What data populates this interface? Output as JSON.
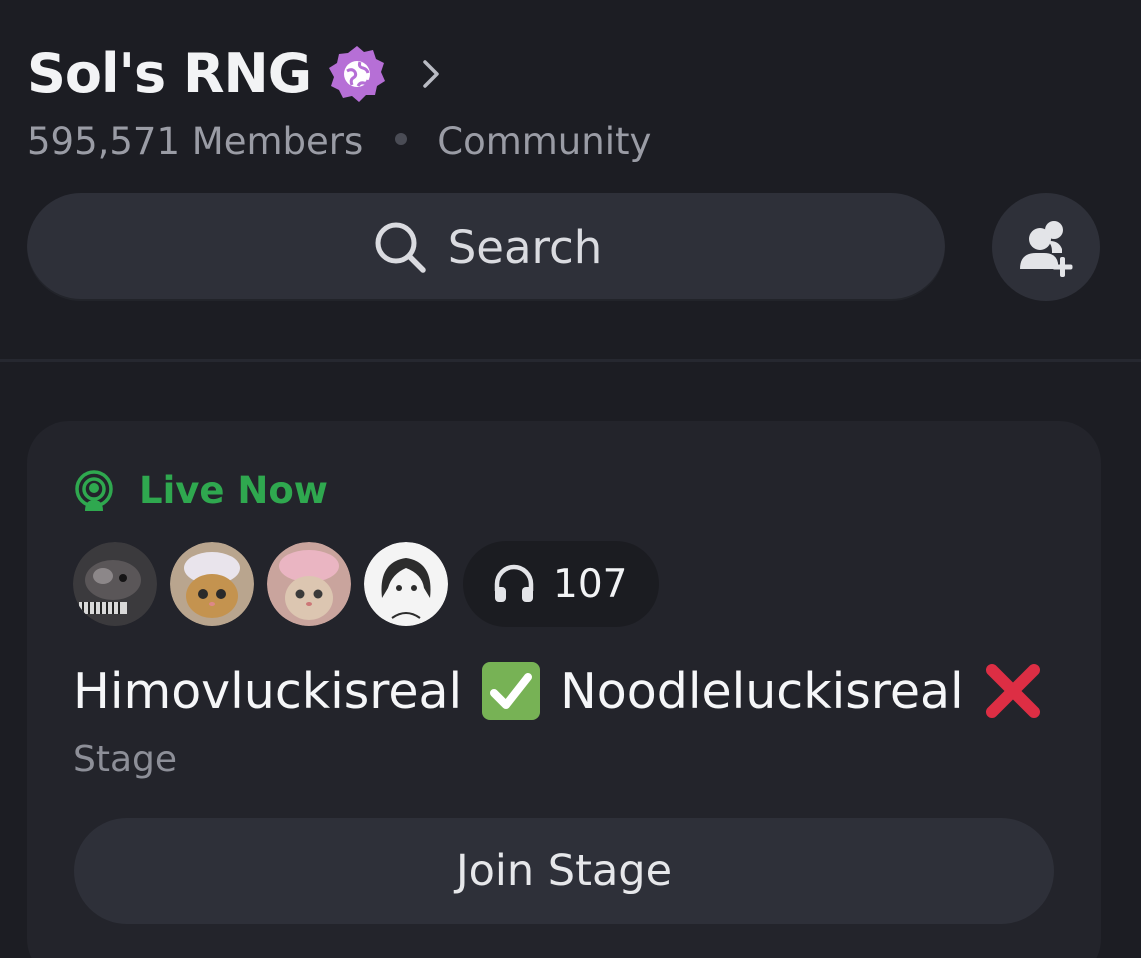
{
  "server": {
    "name": "Sol's RNG",
    "badge_icon": "community-globe-badge-icon",
    "badge_color": "#b66fd6",
    "members": "595,571 Members",
    "type": "Community"
  },
  "search": {
    "label": "Search",
    "icon": "search-icon"
  },
  "invite": {
    "icon": "add-member-icon"
  },
  "stage": {
    "status": "Live Now",
    "status_color": "#2fa84f",
    "listener_count": "107",
    "title_part1": "Himovluckisreal",
    "title_part2": "Noodleluckisreal",
    "type": "Stage",
    "join_label": "Join Stage",
    "avatars": [
      "cat-avatar",
      "cat-avatar",
      "cat-avatar",
      "anime-avatar"
    ]
  }
}
